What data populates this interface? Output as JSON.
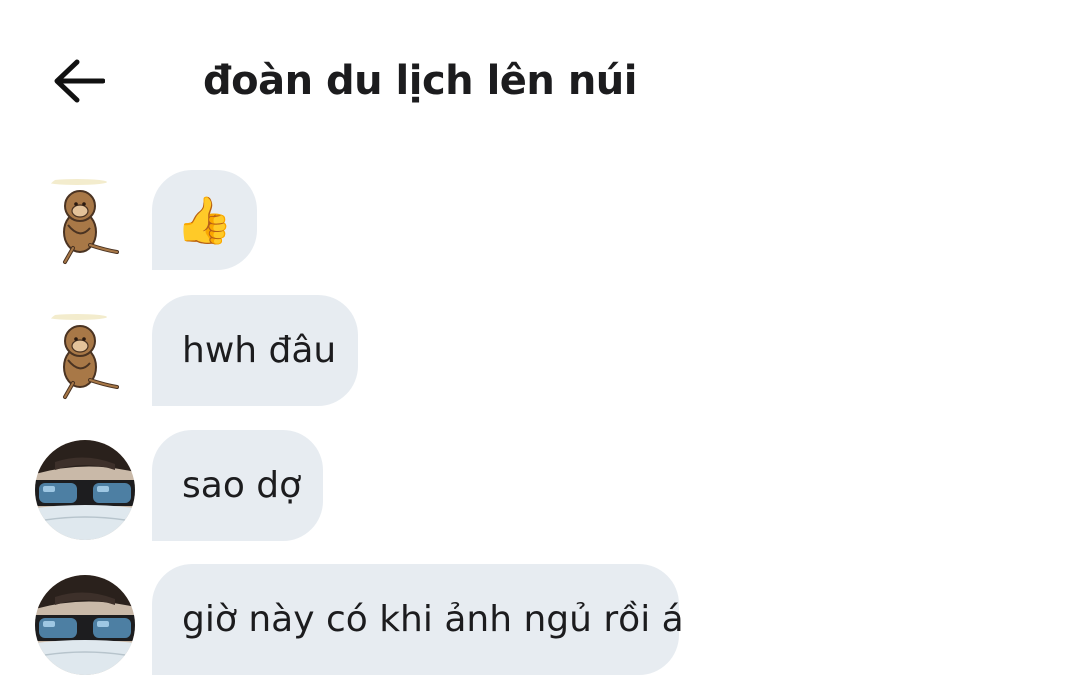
{
  "header": {
    "back_icon": "arrow-left-icon",
    "title": "đoàn du lịch lên núi"
  },
  "messages": [
    {
      "sender_avatar": "monkey-sticker-avatar",
      "type": "emoji",
      "content": "👍",
      "icon": "thumbs-up-icon"
    },
    {
      "sender_avatar": "monkey-sticker-avatar",
      "type": "text",
      "content": "hwh đâu"
    },
    {
      "sender_avatar": "sunglasses-mask-avatar",
      "type": "text",
      "content": "sao dợ"
    },
    {
      "sender_avatar": "sunglasses-mask-avatar",
      "type": "text",
      "content": "giờ này có khi ảnh ngủ rồi á"
    }
  ],
  "colors": {
    "bubble_background": "#e7ecf1",
    "text": "#1c1c1e",
    "background": "#ffffff"
  }
}
